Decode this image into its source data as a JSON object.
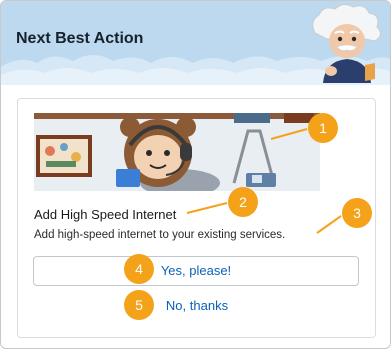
{
  "header": {
    "title": "Next Best Action",
    "mascot_icon": "einstein-mascot-icon",
    "bg_color": "#bcd9ef"
  },
  "card": {
    "banner_image": "astro-headset-illustration",
    "offer_title": "Add High Speed Internet",
    "offer_description": "Add high-speed internet to your existing services.",
    "accept_label": "Yes, please!",
    "reject_label": "No, thanks"
  },
  "callouts": {
    "color": "#f5a21b",
    "items": [
      "1",
      "2",
      "3",
      "4",
      "5"
    ]
  },
  "colors": {
    "link": "#0b62b8",
    "title": "#17212c"
  }
}
